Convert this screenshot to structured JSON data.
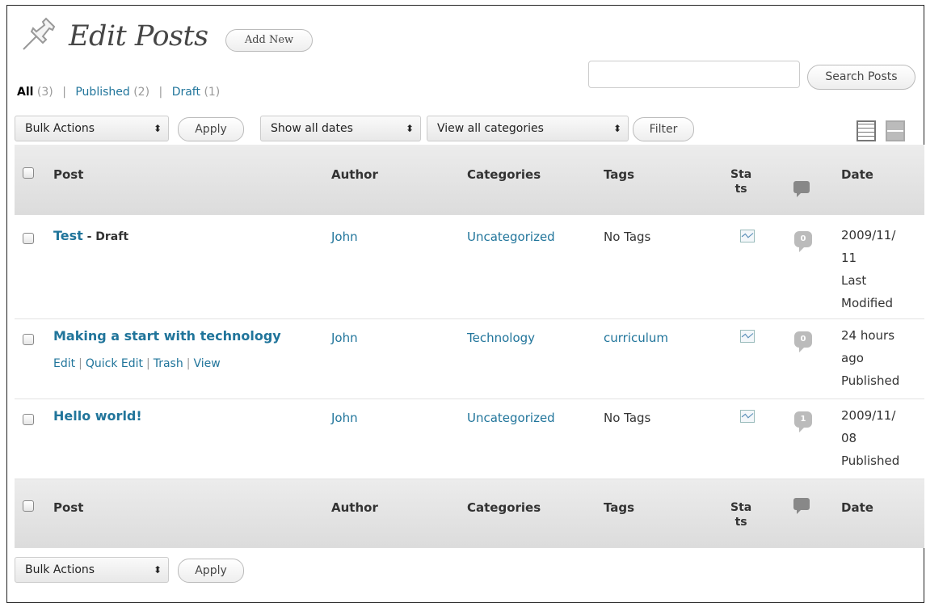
{
  "header": {
    "title": "Edit Posts",
    "add_new": "Add New",
    "icon": "pushpin-icon"
  },
  "filters_links": {
    "all": "All",
    "all_count": "(3)",
    "published": "Published",
    "published_count": "(2)",
    "draft": "Draft",
    "draft_count": "(1)",
    "separator": "|"
  },
  "search": {
    "value": "",
    "button": "Search Posts"
  },
  "tablenav": {
    "bulk_actions": "Bulk Actions",
    "apply": "Apply",
    "dates": "Show all dates",
    "categories": "View all categories",
    "filter": "Filter",
    "select_arrow": "⬍"
  },
  "columns": {
    "post": "Post",
    "author": "Author",
    "categories": "Categories",
    "tags": "Tags",
    "stats_1": "Sta",
    "stats_2": "ts",
    "date": "Date"
  },
  "rows": [
    {
      "title": "Test",
      "state": "- Draft",
      "author": "John",
      "category": "Uncategorized",
      "tags": "No Tags",
      "comments": "0",
      "date_1": "2009/11/",
      "date_2": "11",
      "date_3": "Last",
      "date_4": "Modified"
    },
    {
      "title": "Making a start with technology",
      "author": "John",
      "category": "Technology",
      "tags": "curriculum",
      "comments": "0",
      "date_1": "24 hours",
      "date_2": "ago",
      "date_3": "Published",
      "actions": {
        "edit": "Edit",
        "quick_edit": "Quick Edit",
        "trash": "Trash",
        "view": "View",
        "separator": "|"
      }
    },
    {
      "title": "Hello world!",
      "author": "John",
      "category": "Uncategorized",
      "tags": "No Tags",
      "comments": "1",
      "date_1": "2009/11/",
      "date_2": "08",
      "date_3": "Published"
    }
  ],
  "colors": {
    "link": "#21759b",
    "header_bg": "#dfdfdf",
    "bubble": "#bbbbbb"
  }
}
